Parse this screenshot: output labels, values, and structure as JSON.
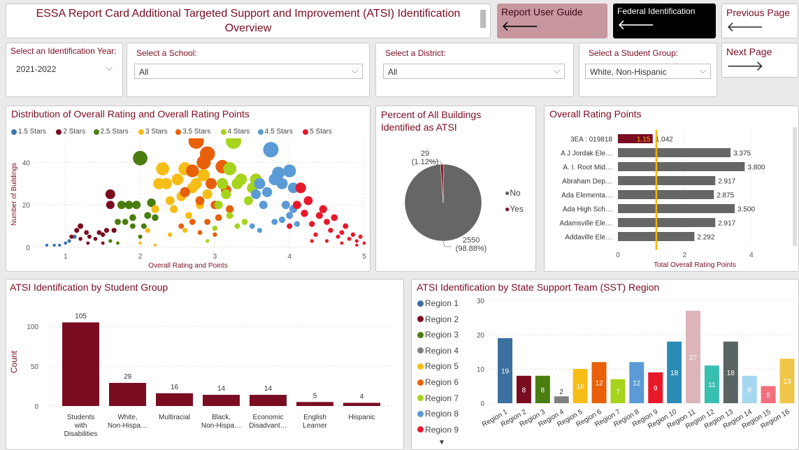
{
  "header": {
    "title": "ESSA Report Card Additional Targeted Support and Improvement (ATSI) Identification Overview",
    "buttons": {
      "user_guide": "Report User Guide",
      "federal": "Federal Identification",
      "previous": "Previous Page",
      "next": "Next Page",
      "left_arrow": "🡐",
      "right_arrow": "🡒"
    }
  },
  "filters": {
    "year_label": "Select an Identification Year:",
    "year_value": "2021-2022",
    "school_label": "Select a School:",
    "school_value": "All",
    "district_label": "Select a District:",
    "district_value": "All",
    "group_label": "Select a Student Group:",
    "group_value": "White, Non-Hispanic",
    "chevron": "⌵"
  },
  "colors": {
    "maroon": "#7a0c22",
    "bar_gray": "#666666",
    "reference_line": "#f2b705"
  },
  "scatter": {
    "title": "Distribution of Overall Rating and Overall Rating Points",
    "legend": [
      {
        "label": "1.5 Stars",
        "color": "#3b75af"
      },
      {
        "label": "2 Stars",
        "color": "#7a0c22"
      },
      {
        "label": "2.5 Stars",
        "color": "#4a7d0f"
      },
      {
        "label": "3 Stars",
        "color": "#f6bd16"
      },
      {
        "label": "3.5 Stars",
        "color": "#e8600a"
      },
      {
        "label": "4 Stars",
        "color": "#a6d31c"
      },
      {
        "label": "4.5 Stars",
        "color": "#5b9bd5"
      },
      {
        "label": "5 Stars",
        "color": "#e8182b"
      }
    ],
    "ylabel": "Number of Buildings",
    "xlabel": "Overall Rating and Points",
    "xticks": [
      "1",
      "2",
      "3",
      "4",
      "5"
    ],
    "yticks": [
      "0",
      "20",
      "40"
    ]
  },
  "pie": {
    "title": "Percent of All Buildings Identified as ATSI",
    "yes_label": "29",
    "yes_pct": "(1.12%)",
    "no_label": "2550",
    "no_pct": "(98.88%)",
    "legend_no": "No",
    "legend_yes": "Yes",
    "legend_marker": "●"
  },
  "rating": {
    "title": "Overall Rating Points",
    "xlabel": "Total Overall Rating Points",
    "xticks": [
      "0",
      "2",
      "4"
    ],
    "highlight_value": "1.15",
    "reference_value": 1.15
  },
  "group_chart": {
    "title": "ATSI Identification by Student Group",
    "ylabel": "Count",
    "yticks": [
      "0",
      "50",
      "100"
    ]
  },
  "region_chart": {
    "title": "ATSI Identification by State Support Team (SST) Region",
    "legend": [
      {
        "label": "Region 1",
        "color": "#3a6f9e"
      },
      {
        "label": "Region 2",
        "color": "#7a0c22"
      },
      {
        "label": "Region 3",
        "color": "#4a7d0f"
      },
      {
        "label": "Region 4",
        "color": "#808080"
      },
      {
        "label": "Region 5",
        "color": "#f6bd16"
      },
      {
        "label": "Region 6",
        "color": "#e8600a"
      },
      {
        "label": "Region 7",
        "color": "#a6d31c"
      },
      {
        "label": "Region 8",
        "color": "#5b9bd5"
      },
      {
        "label": "Region 9",
        "color": "#e8182b"
      }
    ],
    "more_marker": "▼",
    "yticks": [
      "0",
      "10",
      "20",
      "30"
    ]
  },
  "chart_data": [
    {
      "type": "scatter",
      "title": "Distribution of Overall Rating and Overall Rating Points",
      "xlabel": "Overall Rating and Points",
      "ylabel": "Number of Buildings",
      "xlim": [
        0.6,
        5
      ],
      "ylim": [
        0,
        50
      ],
      "series": [
        {
          "name": "1.5 Stars",
          "points": [
            [
              0.75,
              1
            ],
            [
              0.85,
              1
            ],
            [
              0.92,
              1
            ],
            [
              1.0,
              2
            ],
            [
              1.05,
              3
            ],
            [
              1.12,
              5
            ]
          ]
        },
        {
          "name": "2 Stars",
          "points": [
            [
              1.08,
              5
            ],
            [
              1.15,
              8
            ],
            [
              1.2,
              10
            ],
            [
              1.28,
              7
            ],
            [
              1.32,
              5
            ],
            [
              1.4,
              4
            ],
            [
              1.45,
              7
            ],
            [
              1.5,
              6
            ],
            [
              1.55,
              8
            ],
            [
              1.6,
              25
            ],
            [
              1.6,
              20
            ],
            [
              1.65,
              8
            ],
            [
              1.2,
              4
            ],
            [
              1.3,
              2
            ],
            [
              1.5,
              2
            ]
          ]
        },
        {
          "name": "2.5 Stars",
          "points": [
            [
              1.6,
              3
            ],
            [
              1.7,
              12
            ],
            [
              1.75,
              20
            ],
            [
              1.8,
              12
            ],
            [
              1.85,
              20
            ],
            [
              1.9,
              14
            ],
            [
              1.95,
              20
            ],
            [
              2.0,
              42
            ],
            [
              2.05,
              10
            ],
            [
              2.1,
              15
            ],
            [
              2.15,
              21
            ],
            [
              2.2,
              14
            ],
            [
              1.9,
              10
            ],
            [
              1.7,
              2
            ],
            [
              2.0,
              5
            ]
          ]
        },
        {
          "name": "3 Stars",
          "points": [
            [
              2.0,
              2
            ],
            [
              2.1,
              8
            ],
            [
              2.2,
              18
            ],
            [
              2.25,
              30
            ],
            [
              2.3,
              37
            ],
            [
              2.35,
              30
            ],
            [
              2.4,
              22
            ],
            [
              2.45,
              18
            ],
            [
              2.5,
              32
            ],
            [
              2.55,
              24
            ],
            [
              2.6,
              37
            ],
            [
              2.65,
              15
            ],
            [
              2.7,
              28
            ],
            [
              2.75,
              30
            ],
            [
              2.8,
              20
            ],
            [
              2.85,
              34
            ],
            [
              2.9,
              25
            ],
            [
              2.2,
              1
            ],
            [
              2.4,
              6
            ],
            [
              2.6,
              8
            ]
          ]
        },
        {
          "name": "3.5 Stars",
          "points": [
            [
              2.55,
              10
            ],
            [
              2.6,
              26
            ],
            [
              2.7,
              36
            ],
            [
              2.75,
              50
            ],
            [
              2.8,
              22
            ],
            [
              2.85,
              40
            ],
            [
              2.9,
              44
            ],
            [
              2.95,
              30
            ],
            [
              3.0,
              20
            ],
            [
              3.05,
              14
            ],
            [
              3.1,
              38
            ],
            [
              3.15,
              27
            ],
            [
              3.2,
              18
            ],
            [
              2.8,
              7
            ],
            [
              2.9,
              12
            ],
            [
              3.0,
              6
            ],
            [
              2.7,
              12
            ]
          ]
        },
        {
          "name": "4 Stars",
          "points": [
            [
              2.9,
              3
            ],
            [
              3.0,
              9
            ],
            [
              3.05,
              20
            ],
            [
              3.1,
              30
            ],
            [
              3.15,
              25
            ],
            [
              3.2,
              37
            ],
            [
              3.25,
              50
            ],
            [
              3.3,
              30
            ],
            [
              3.35,
              32
            ],
            [
              3.4,
              12
            ],
            [
              3.45,
              22
            ],
            [
              3.5,
              28
            ],
            [
              3.55,
              32
            ],
            [
              3.2,
              15
            ],
            [
              3.3,
              10
            ]
          ]
        },
        {
          "name": "4.5 Stars",
          "points": [
            [
              3.5,
              10
            ],
            [
              3.55,
              25
            ],
            [
              3.6,
              30
            ],
            [
              3.65,
              20
            ],
            [
              3.7,
              26
            ],
            [
              3.75,
              46
            ],
            [
              3.8,
              32
            ],
            [
              3.85,
              35
            ],
            [
              3.9,
              30
            ],
            [
              3.95,
              20
            ],
            [
              4.0,
              36
            ],
            [
              4.05,
              28
            ],
            [
              3.6,
              8
            ],
            [
              3.8,
              12
            ],
            [
              3.9,
              13
            ],
            [
              4.0,
              15
            ],
            [
              4.05,
              18
            ],
            [
              4.1,
              11
            ]
          ]
        },
        {
          "name": "5 Stars",
          "points": [
            [
              4.0,
              10
            ],
            [
              4.1,
              20
            ],
            [
              4.15,
              28
            ],
            [
              4.2,
              16
            ],
            [
              4.25,
              22
            ],
            [
              4.3,
              11
            ],
            [
              4.35,
              6
            ],
            [
              4.4,
              15
            ],
            [
              4.45,
              18
            ],
            [
              4.5,
              12
            ],
            [
              4.55,
              8
            ],
            [
              4.6,
              14
            ],
            [
              4.65,
              5
            ],
            [
              4.7,
              7
            ],
            [
              4.75,
              10
            ],
            [
              4.8,
              4
            ],
            [
              4.85,
              6
            ],
            [
              4.9,
              3
            ],
            [
              4.95,
              5
            ],
            [
              5.0,
              2
            ],
            [
              4.5,
              3
            ],
            [
              4.7,
              2
            ],
            [
              4.9,
              1
            ],
            [
              4.3,
              3
            ]
          ]
        }
      ]
    },
    {
      "type": "pie",
      "title": "Percent of All Buildings Identified as ATSI",
      "slices": [
        {
          "label": "No",
          "value": 2550,
          "percent": 98.88,
          "color": "#666666"
        },
        {
          "label": "Yes",
          "value": 29,
          "percent": 1.12,
          "color": "#7a0c22"
        }
      ]
    },
    {
      "type": "bar",
      "orientation": "horizontal",
      "title": "Overall Rating Points",
      "xlabel": "Total Overall Rating Points",
      "xlim": [
        0,
        4.4
      ],
      "categories": [
        "3EA : 019818",
        "A J Jordak Ele…",
        "A. I. Root Mid…",
        "Abraham Dep…",
        "Ada Elementa…",
        "Ada High Sch…",
        "Adamsville Ele…",
        "Addaville Ele…"
      ],
      "values": [
        1.042,
        3.375,
        3.8,
        2.917,
        2.875,
        3.5,
        2.917,
        2.292
      ],
      "value_labels": [
        "1.042",
        "3.375",
        "3.800",
        "2.917",
        "2.875",
        "3.500",
        "2.917",
        "2.292"
      ],
      "reference_line": 1.15
    },
    {
      "type": "bar",
      "title": "ATSI Identification by Student Group",
      "ylabel": "Count",
      "ylim": [
        0,
        115
      ],
      "categories": [
        [
          "Students",
          "with",
          "Disabilities"
        ],
        [
          "White,",
          "Non-Hispa…"
        ],
        [
          "Multiracial"
        ],
        [
          "Black,",
          "Non-Hispa…"
        ],
        [
          "Economic",
          "Disadvant…"
        ],
        [
          "English",
          "Learner"
        ],
        [
          "Hispanic"
        ]
      ],
      "values": [
        105,
        29,
        16,
        14,
        14,
        5,
        4
      ]
    },
    {
      "type": "bar",
      "title": "ATSI Identification by State Support Team (SST) Region",
      "ylim": [
        0,
        30
      ],
      "categories": [
        "Region 1",
        "Region 2",
        "Region 3",
        "Region 4",
        "Region 5",
        "Region 6",
        "Region 7",
        "Region 8",
        "Region 9",
        "Region 10",
        "Region 11",
        "Region 12",
        "Region 13",
        "Region 14",
        "Region 15",
        "Region 16"
      ],
      "values": [
        19,
        8,
        8,
        2,
        10,
        12,
        7,
        12,
        9,
        18,
        27,
        11,
        18,
        8,
        5,
        13
      ],
      "colors": [
        "#3a6f9e",
        "#7a0c22",
        "#4a7d0f",
        "#808080",
        "#f6bd16",
        "#e8600a",
        "#a6d31c",
        "#5b9bd5",
        "#e8182b",
        "#2b8cb5",
        "#dbb5b9",
        "#38bfb0",
        "#5a6462",
        "#a5d8ee",
        "#f26e7d",
        "#f0c64a"
      ]
    }
  ]
}
